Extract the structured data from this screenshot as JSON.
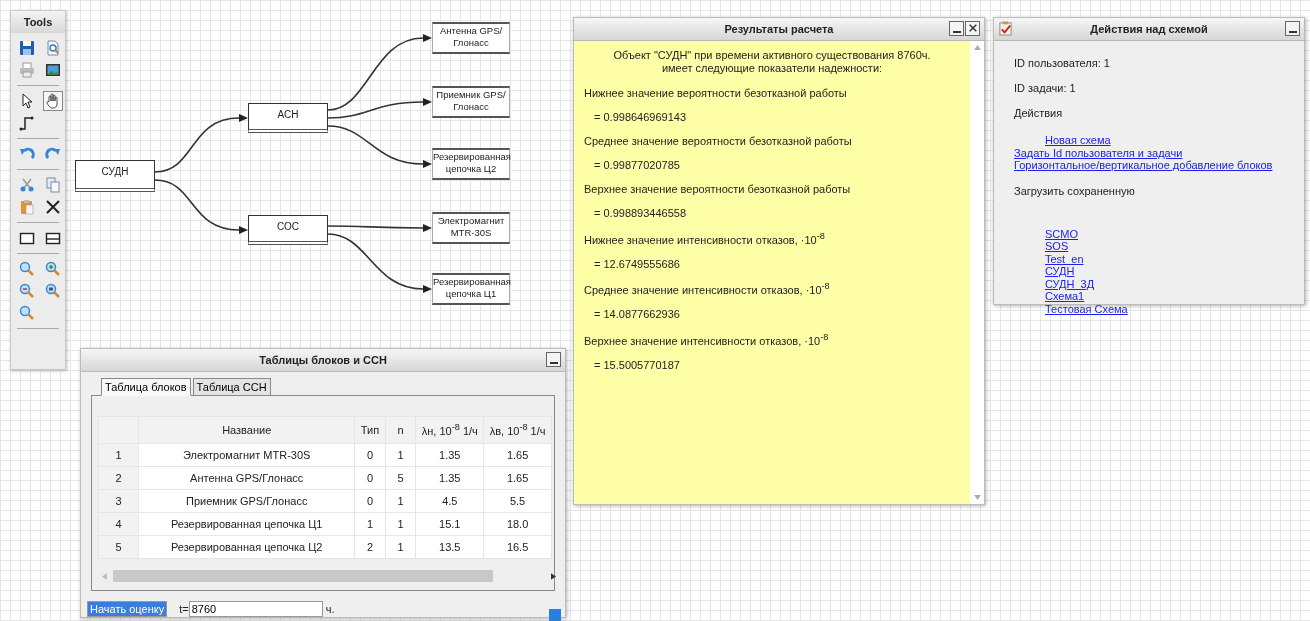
{
  "tools": {
    "title": "Tools",
    "groups": [
      [
        {
          "selected": false
        },
        {
          "selected": false
        },
        {
          "selected": false
        },
        {
          "selected": false
        }
      ],
      [
        {
          "selected": false
        },
        {
          "selected": true
        },
        {
          "selected": false
        }
      ],
      [
        {
          "selected": false
        },
        {
          "selected": false
        }
      ],
      [
        {
          "selected": false
        },
        {
          "selected": false
        },
        {
          "selected": false
        },
        {
          "selected": false
        }
      ],
      [
        {
          "selected": false
        },
        {
          "selected": false
        }
      ],
      [
        {
          "selected": false
        },
        {
          "selected": false
        },
        {
          "selected": false
        },
        {
          "selected": false
        },
        {
          "selected": false
        }
      ]
    ]
  },
  "diagram": {
    "nodes": [
      {
        "label": "СУДН",
        "kind": "block"
      },
      {
        "label": "АСН",
        "kind": "block"
      },
      {
        "label": "СОС",
        "kind": "block"
      },
      {
        "label": "Антенна GPS/ Глонасс",
        "kind": "element"
      },
      {
        "label": "Приемник GPS/Глонасс",
        "kind": "element"
      },
      {
        "label": "Резервированная цепочка Ц2",
        "kind": "element"
      },
      {
        "label": "Электромагнит MTR-30S",
        "kind": "element"
      },
      {
        "label": "Резервированная цепочка Ц1",
        "kind": "element"
      }
    ]
  },
  "results_window": {
    "title": "Результаты расчета",
    "intro": "Объект \"СУДН\" при времени активного существования 8760ч. имеет следующие показатели надежности:",
    "items": [
      {
        "label": "Нижнее значение вероятности безотказной работы",
        "value": "= 0.998646969143"
      },
      {
        "label": "Среднее значение вероятности безотказной работы",
        "value": "= 0.99877020785"
      },
      {
        "label": "Верхнее значение вероятности безотказной работы",
        "value": "= 0.998893446558"
      },
      {
        "label": "Нижнее значение интенсивности отказов, ·10$^{-8}$",
        "value": "= 12.6749555686"
      },
      {
        "label": "Среднее значение интенсивности отказов, ·10$^{-8}$",
        "value": "= 14.0877662936"
      },
      {
        "label": "Верхнее значение интенсивности отказов, ·10$^{-8}$",
        "value": "= 15.5005770187"
      }
    ]
  },
  "actions_window": {
    "title": "Действия над схемой",
    "user_id": "ID пользователя: 1",
    "task_id": "ID задачи: 1",
    "actions_heading": "Действия",
    "action_links": [
      "Новая схема",
      "Задать Id пользователя и задачи",
      "Горизонтальное/вертикальное добавление блоков"
    ],
    "load_heading": "Загрузить сохраненную",
    "saved_links": [
      "SCMO",
      "SOS",
      "Test_en",
      "СУДН",
      "СУДН_3Д",
      "Схема1",
      "Тестовая Схема"
    ]
  },
  "tables_window": {
    "title": "Таблицы блоков и ССН",
    "tabs": [
      {
        "label": "Таблица блоков",
        "selected": true
      },
      {
        "label": "Таблица ССН",
        "selected": false
      }
    ],
    "columns": [
      "",
      "Название",
      "Тип",
      "n",
      "λн, 10$^{-8}$ 1/ч",
      "λв, 10$^{-8}$ 1/ч"
    ],
    "rows": [
      [
        "1",
        "Электромагнит MTR-30S",
        "0",
        "1",
        "1.35",
        "1.65"
      ],
      [
        "2",
        "Антенна GPS/Глонасс",
        "0",
        "5",
        "1.35",
        "1.65"
      ],
      [
        "3",
        "Приемник GPS/Глонасс",
        "0",
        "1",
        "4.5",
        "5.5"
      ],
      [
        "4",
        "Резервированная цепочка Ц1",
        "1",
        "1",
        "15.1",
        "18.0"
      ],
      [
        "5",
        "Резервированная цепочка Ц2",
        "2",
        "1",
        "13.5",
        "16.5"
      ]
    ],
    "start_button": "Начать оценку",
    "time_label": "t=",
    "time_value": "8760",
    "time_unit": "ч."
  }
}
